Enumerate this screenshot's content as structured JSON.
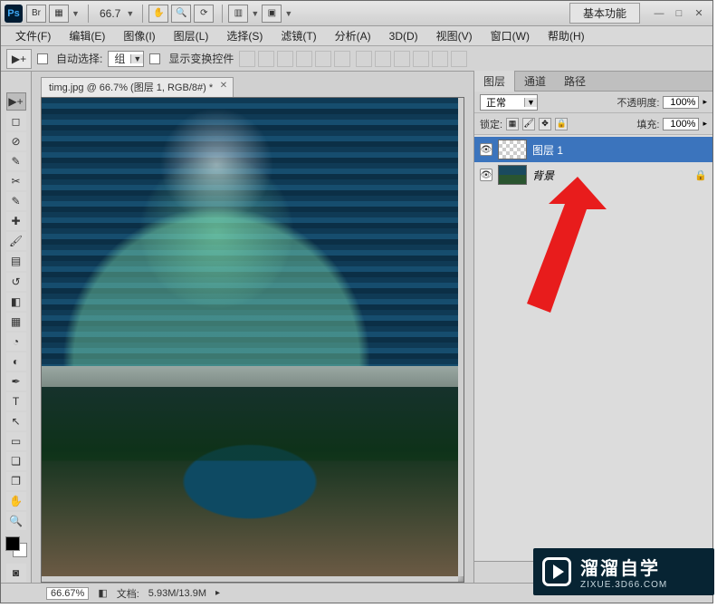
{
  "titlebar": {
    "logo": "Ps",
    "zoom": "66.7",
    "workspace": "基本功能"
  },
  "menu": {
    "file": "文件(F)",
    "edit": "编辑(E)",
    "image": "图像(I)",
    "layer": "图层(L)",
    "select": "选择(S)",
    "filter": "滤镜(T)",
    "analysis": "分析(A)",
    "threeD": "3D(D)",
    "view": "视图(V)",
    "window": "窗口(W)",
    "help": "帮助(H)"
  },
  "options": {
    "autoSelect": "自动选择:",
    "group": "组",
    "showTransform": "显示变换控件"
  },
  "docTab": {
    "title": "timg.jpg @ 66.7% (图层 1, RGB/8#) *"
  },
  "panels": {
    "tabs": {
      "layers": "图层",
      "channels": "通道",
      "paths": "路径"
    },
    "blendMode": "正常",
    "opacityLabel": "不透明度:",
    "opacityValue": "100%",
    "lockLabel": "锁定:",
    "fillLabel": "填充:",
    "fillValue": "100%",
    "layer1": "图层 1",
    "background": "背景"
  },
  "status": {
    "zoom": "66.67%",
    "docLabel": "文档:",
    "docSize": "5.93M/13.9M"
  },
  "watermark": {
    "line1": "溜溜自学",
    "line2": "ZIXUE.3D66.COM"
  }
}
